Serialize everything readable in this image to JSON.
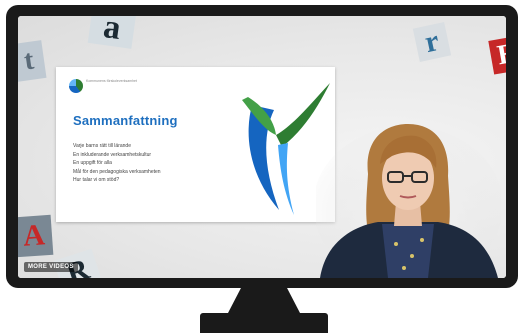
{
  "slide": {
    "org_name": "Kommunens förskoleverksamhet",
    "title": "Sammanfattning",
    "bullets": [
      "Varje barns rätt till lärande",
      "En inkluderande verksamhetskultur",
      "En uppgift för alla",
      "Mål för den pedagogiska verksamheten",
      "Hur talar vi om stöd?"
    ]
  },
  "tiles": {
    "t": "t",
    "a": "a",
    "r": "r",
    "e": "E",
    "A": "A",
    "R": "R"
  },
  "player": {
    "more_videos_label": "MORE VIDEOS"
  }
}
